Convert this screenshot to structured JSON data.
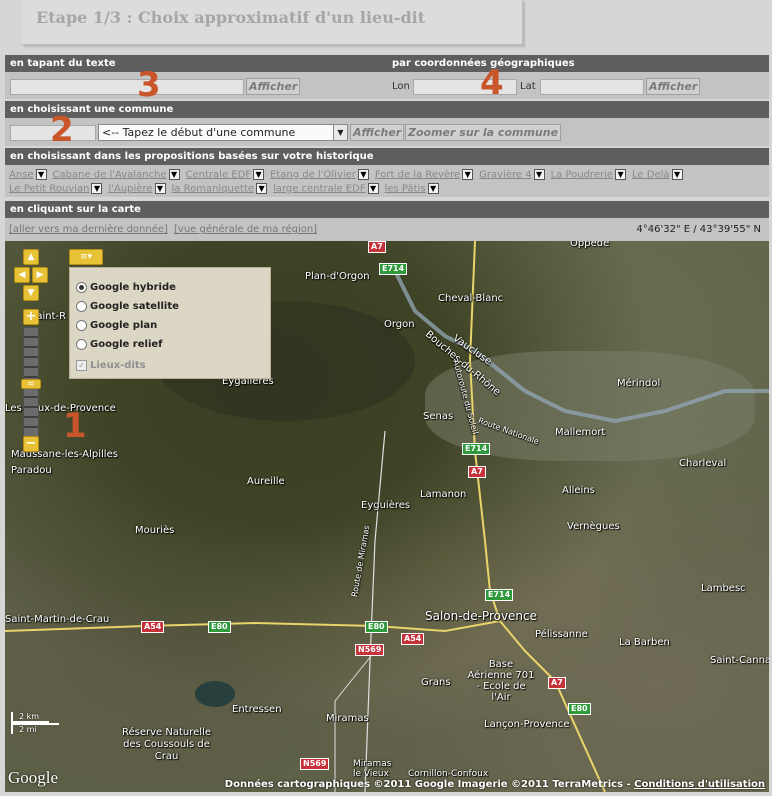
{
  "title": "Etape 1/3 : Choix approximatif d'un lieu-dit",
  "text_section": {
    "heading": "en tapant du texte",
    "value": "",
    "button": "Afficher",
    "marker": "3"
  },
  "coord_section": {
    "heading": "par coordonnées géographiques",
    "lon_label": "Lon",
    "lon_value": "",
    "lat_label": "Lat",
    "lat_value": "",
    "button": "Afficher",
    "marker": "4"
  },
  "commune_section": {
    "heading": "en choisissant une commune",
    "code_value": "",
    "select_value": "<-- Tapez le début d'une commune",
    "button": "Afficher",
    "zoom_button": "Zoomer sur la commune",
    "marker": "2"
  },
  "history_section": {
    "heading": "en choisissant dans les propositions basées sur votre historique",
    "items": [
      "Anse",
      "Cabane de l'Avalanche",
      "Centrale EDF",
      "Etang de l'Olivier",
      "Fort de la Revère",
      "Gravière 4",
      "La Poudrerie",
      "Le Delà",
      "Le Petit Rouvian",
      "l'Aupière",
      "la Romaniquette",
      "large centrale EDF",
      "les Pâtis"
    ]
  },
  "map_section": {
    "heading": "en cliquant sur la carte",
    "link_last": "[aller vers ma dernière donnée]",
    "link_region": "[vue générale de ma région]",
    "coords": "4°46'32\" E / 43°39'55\" N",
    "marker": "1"
  },
  "map": {
    "layer_options": [
      "Google hybride",
      "Google satellite",
      "Google plan",
      "Google relief"
    ],
    "selected_layer": "Google hybride",
    "overlay_option": "Lieux-dits",
    "places": [
      "Plan-d'Orgon",
      "Cheval-Blanc",
      "Orgon",
      "Vaucluse",
      "Bouches-du-Rhône",
      "Eygalières",
      "Mérindol",
      "Senas",
      "Mallemort",
      "Charleval",
      "Les Baux-de-Provence",
      "Maussane-les-Alpilles",
      "Paradou",
      "Aureille",
      "Lamanon",
      "Alleins",
      "Eyguières",
      "Vernègues",
      "Mouriès",
      "Lambesc",
      "Saint-Martin-de-Crau",
      "Salon-de-Provence",
      "Pélissanne",
      "La Barben",
      "Saint-Cannat",
      "Base Aérienne 701 - Ecole de l'Air",
      "Grans",
      "Entressen",
      "Miramas",
      "Lançon-Provence",
      "Réserve Naturelle des Coussouls de Crau",
      "Miramas le Vieux",
      "Cornillon-Confoux",
      "Saint-R",
      "Route de Miramas",
      "Autoroute du Soleil",
      "Route Nationale",
      "Oppède"
    ],
    "roads": [
      "A7",
      "E714",
      "A54",
      "E80",
      "N569",
      "A7",
      "E714",
      "E80",
      "A54",
      "N569",
      "A7",
      "E714",
      "E80"
    ],
    "scale_km": "2 km",
    "scale_mi": "2 mi",
    "logo": "Google",
    "attribution": "Données cartographiques ©2011 Google  Imagerie ©2011 TerraMetrics - ",
    "terms": "Conditions d'utilisation"
  }
}
